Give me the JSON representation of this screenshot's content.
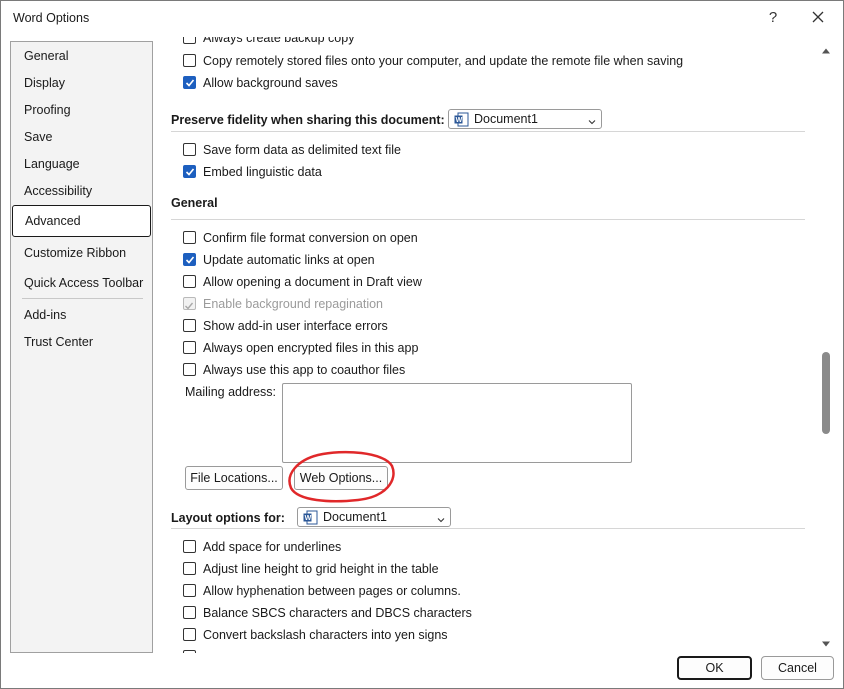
{
  "window": {
    "title": "Word Options",
    "help_label": "?"
  },
  "nav": {
    "items": [
      {
        "label": "General"
      },
      {
        "label": "Display"
      },
      {
        "label": "Proofing"
      },
      {
        "label": "Save"
      },
      {
        "label": "Language"
      },
      {
        "label": "Accessibility"
      },
      {
        "label": "Advanced",
        "selected": true
      },
      {
        "label": "Customize Ribbon"
      },
      {
        "label": "Quick Access Toolbar"
      },
      {
        "label": "Add-ins"
      },
      {
        "label": "Trust Center"
      }
    ]
  },
  "save_section": {
    "items": [
      {
        "label": "Always create backup copy",
        "checked": false
      },
      {
        "label": "Copy remotely stored files onto your computer, and update the remote file when saving",
        "checked": false
      },
      {
        "label": "Allow background saves",
        "checked": true
      }
    ]
  },
  "fidelity": {
    "heading": "Preserve fidelity when sharing this document:",
    "document": "Document1",
    "items": [
      {
        "label": "Save form data as delimited text file",
        "checked": false
      },
      {
        "label": "Embed linguistic data",
        "checked": true
      }
    ]
  },
  "general": {
    "heading": "General",
    "items": [
      {
        "label": "Confirm file format conversion on open",
        "checked": false
      },
      {
        "label": "Update automatic links at open",
        "checked": true
      },
      {
        "label": "Allow opening a document in Draft view",
        "checked": false
      },
      {
        "label": "Enable background repagination",
        "checked": true,
        "disabled": true
      },
      {
        "label": "Show add-in user interface errors",
        "checked": false
      },
      {
        "label": "Always open encrypted files in this app",
        "checked": false
      },
      {
        "label": "Always use this app to coauthor files",
        "checked": false
      }
    ],
    "mailing_label": "Mailing address:",
    "mailing_value": "",
    "file_locations_button": "File Locations...",
    "web_options_button": "Web Options..."
  },
  "layout": {
    "heading": "Layout options for:",
    "document": "Document1",
    "items": [
      {
        "label": "Add space for underlines",
        "checked": false
      },
      {
        "label": "Adjust line height to grid height in the table",
        "checked": false
      },
      {
        "label": "Allow hyphenation between pages or columns.",
        "checked": false
      },
      {
        "label": "Balance SBCS characters and DBCS characters",
        "checked": false
      },
      {
        "label": "Convert backslash characters into yen signs",
        "checked": false
      }
    ]
  },
  "footer": {
    "ok_label": "OK",
    "cancel_label": "Cancel"
  },
  "colors": {
    "accent": "#1d5fbf",
    "annotation": "#e0282a"
  }
}
